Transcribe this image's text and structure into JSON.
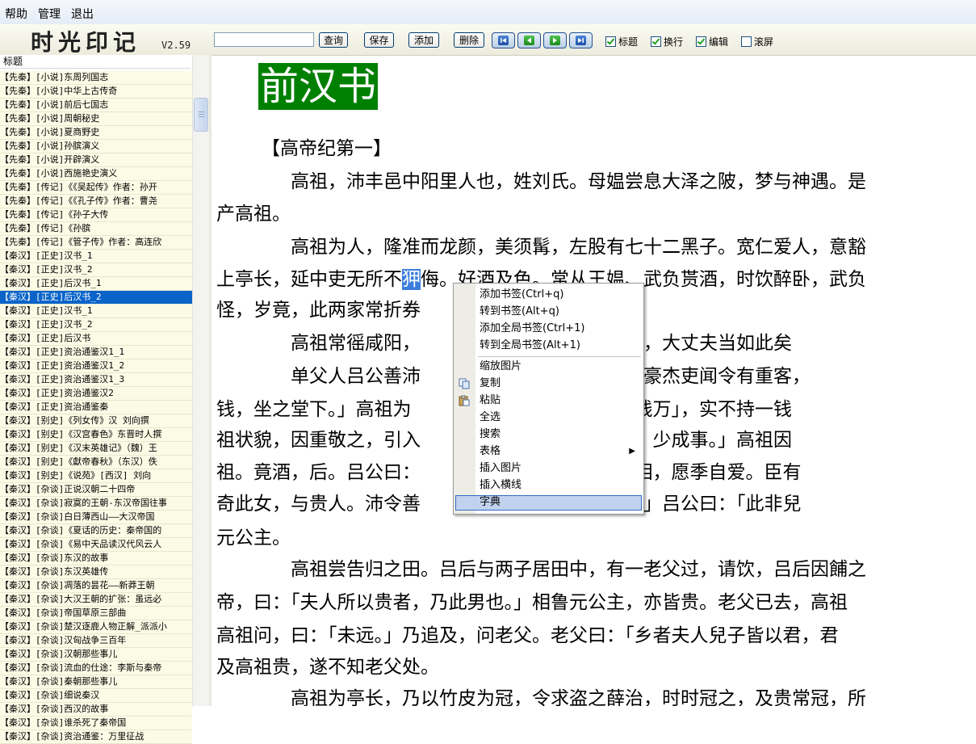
{
  "menu": [
    "帮助",
    "管理",
    "退出"
  ],
  "app": {
    "logo": "时光印记",
    "version": "V2.59"
  },
  "toolbar": {
    "search_value": "",
    "buttons": [
      "查询",
      "保存",
      "添加",
      "删除"
    ],
    "nav_icons": [
      "first-page-icon",
      "prev-page-icon",
      "next-page-icon",
      "last-page-icon"
    ],
    "checkboxes": [
      {
        "label": "标题",
        "checked": true
      },
      {
        "label": "换行",
        "checked": true
      },
      {
        "label": "编辑",
        "checked": true
      },
      {
        "label": "滚屏",
        "checked": false
      }
    ]
  },
  "sidebar": {
    "header": "标题",
    "selected_index": 16,
    "items": [
      "【先秦】[小说]东周列国志",
      "【先秦】[小说]中华上古传奇",
      "【先秦】[小说]前后七国志",
      "【先秦】[小说]周朝秘史",
      "【先秦】[小说]夏商野史",
      "【先秦】[小说]孙膑演义",
      "【先秦】[小说]开辟演义",
      "【先秦】[小说]西施艳史演义",
      "【先秦】[传记]《《吴起传》作者：孙开",
      "【先秦】[传记]《《孔子传》作者：曹尧",
      "【先秦】[传记]《孙子大传",
      "【先秦】[传记]《孙膑",
      "【先秦】[传记]《管子传》作者：高连欣",
      "【秦汉】[正史]汉书_1",
      "【秦汉】[正史]汉书_2",
      "【秦汉】[正史]后汉书_1",
      "【秦汉】[正史]后汉书_2",
      "【秦汉】[正史]汉书_1",
      "【秦汉】[正史]汉书_2",
      "【秦汉】[正史]后汉书",
      "【秦汉】[正史]资治通鉴汉1_1",
      "【秦汉】[正史]资治通鉴汉1_2",
      "【秦汉】[正史]资治通鉴汉1_3",
      "【秦汉】[正史]资治通鉴汉2",
      "【秦汉】[正史]资治通鉴秦",
      "【秦汉】[别史]《列女传》汉 刘向撰",
      "【秦汉】[别史]《汉宫春色》东晋时人撰",
      "【秦汉】[别史]《汉末英雄记》（魏）王",
      "【秦汉】[别史]《獻帝春秋》（东汉）佚",
      "【秦汉】[别史]《说苑》[西汉] 刘向",
      "【秦汉】[杂谈]正说汉朝二十四帝",
      "【秦汉】[杂谈]寂寞的王朝-东汉帝国往事",
      "【秦汉】[杂谈]白日薄西山——大汉帝国",
      "【秦汉】[杂谈]《夏话的历史：秦帝国的",
      "【秦汉】[杂谈]《易中天品读汉代风云人",
      "【秦汉】[杂谈]东汉的故事",
      "【秦汉】[杂谈]东汉英雄传",
      "【秦汉】[杂谈]凋落的昙花——新莽王朝",
      "【秦汉】[杂谈]大汉王朝的扩张：虽远必",
      "【秦汉】[杂谈]帝国草原三部曲",
      "【秦汉】[杂谈]楚汉逐鹿人物正解_派派小",
      "【秦汉】[杂谈]汉匈战争三百年",
      "【秦汉】[杂谈]汉朝那些事儿",
      "【秦汉】[杂谈]流血的仕途：李斯与秦帝",
      "【秦汉】[杂谈]秦朝那些事儿",
      "【秦汉】[杂谈]细说秦汉",
      "【秦汉】[杂谈]西汉的故事",
      "【秦汉】[杂谈]谁杀死了秦帝国",
      "【秦汉】[杂谈]资治通鉴：万里征战"
    ]
  },
  "content": {
    "book_title": "前汉书",
    "chapter_title": "【高帝纪第一】",
    "lines": [
      {
        "text": "　　　　高祖，沛丰邑中阳里人也，姓刘氏。母媪尝息大泽之陂，梦与神遇。是"
      },
      {
        "text": "产高祖。"
      },
      {
        "text": "　　　　高祖为人，隆准而龙颜，美须髯，左股有七十二黑子。宽仁爱人，意豁"
      },
      {
        "text_before": "上亭长，延中吏无所不",
        "text_selected": "狎",
        "text_after": "侮。好酒及色。常从王媪、武负贳酒，时饮醉卧，武负"
      },
      {
        "text": "怪，岁竟，此两家常折券"
      },
      {
        "text": "　　　　高祖常徭咸阳，　　　　　大息，曰：「嗟乎，大丈夫当如此矣"
      },
      {
        "text": "　　　　单父人吕公善沛　　　　　，因家焉。沛中豪杰吏闻令有重客，"
      },
      {
        "text": "钱，坐之堂下。」高祖为　　　　　诒给为谒曰「贺钱万」，实不持一钱"
      },
      {
        "text": "祖状貌，因重敬之，引入　　　　　「刘季固多大言，少成事。」高祖因"
      },
      {
        "text": "祖。竟酒，后。吕公曰：　　　　　人多矣，无如季相，愿季自爱。臣有"
      },
      {
        "text": "奇此女，与贵人。沛令善　　　　　自妄许与刘季？」吕公曰：「此非兒"
      },
      {
        "text": "元公主。"
      },
      {
        "text": "　　　　高祖尝告归之田。吕后与两子居田中，有一老父过，请饮，吕后因餔之"
      },
      {
        "text": "帝，曰：「夫人所以贵者，乃此男也。」相鲁元公主，亦皆贵。老父已去，高祖"
      },
      {
        "text": "高祖问，曰：「未远。」乃追及，问老父。老父曰：「乡者夫人兒子皆以君，君"
      },
      {
        "text": "及高祖贵，遂不知老父处。"
      },
      {
        "text": "　　　　高祖为亭长，乃以竹皮为冠，令求盗之薛治，时时冠之，及贵常冠，所"
      }
    ]
  },
  "context_menu": {
    "items": [
      {
        "label": "添加书签(Ctrl+q)"
      },
      {
        "label": "转到书签(Alt+q)"
      },
      {
        "label": "添加全局书签(Ctrl+1)"
      },
      {
        "label": "转到全局书签(Alt+1)"
      },
      {
        "label": "缩放图片"
      },
      {
        "label": "复制",
        "icon": "copy-icon"
      },
      {
        "label": "粘贴",
        "icon": "paste-icon"
      },
      {
        "label": "全选"
      },
      {
        "label": "搜索"
      },
      {
        "label": "表格",
        "submenu": true
      },
      {
        "label": "插入图片"
      },
      {
        "label": "插入横线"
      },
      {
        "label": "字典",
        "highlighted": true
      }
    ]
  }
}
